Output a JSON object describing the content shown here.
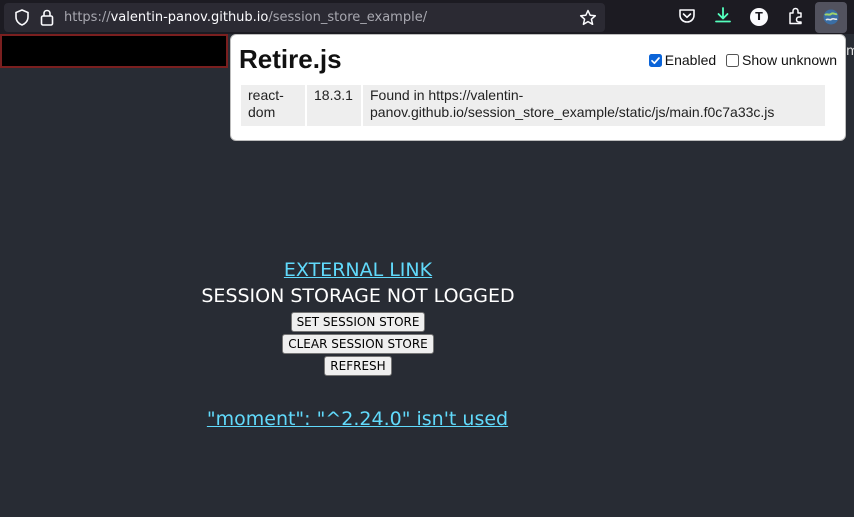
{
  "browser": {
    "url_protocol": "https://",
    "url_host": "valentin-panov.github.io",
    "url_path": "/session_store_example/",
    "profile_initial": "T",
    "icons": [
      "shield-icon",
      "lock-icon",
      "star-icon",
      "pocket-icon",
      "download-icon",
      "extensions-icon",
      "retirejs-extension-icon"
    ]
  },
  "page": {
    "external_link": "EXTERNAL LINK",
    "status": "SESSION STORAGE NOT LOGGED",
    "buttons": {
      "set": "SET SESSION STORE",
      "clear": "CLEAR SESSION STORE",
      "refresh": "REFRESH"
    },
    "moment_link": "\"moment\": \"^2.24.0\" isn't used",
    "edge_char": "m"
  },
  "popup": {
    "title": "Retire.js",
    "enabled_label": "Enabled",
    "enabled_checked": true,
    "show_unknown_label": "Show unknown",
    "show_unknown_checked": false,
    "results": [
      {
        "component": "react-dom",
        "version": "18.3.1",
        "location": "Found in https://valentin-panov.github.io/session_store_example/static/js/main.f0c7a33c.js"
      }
    ]
  },
  "colors": {
    "page_bg": "#282c34",
    "link": "#61dafb",
    "toolbar_bg": "#1c1b22",
    "download_accent": "#54ffbd"
  }
}
